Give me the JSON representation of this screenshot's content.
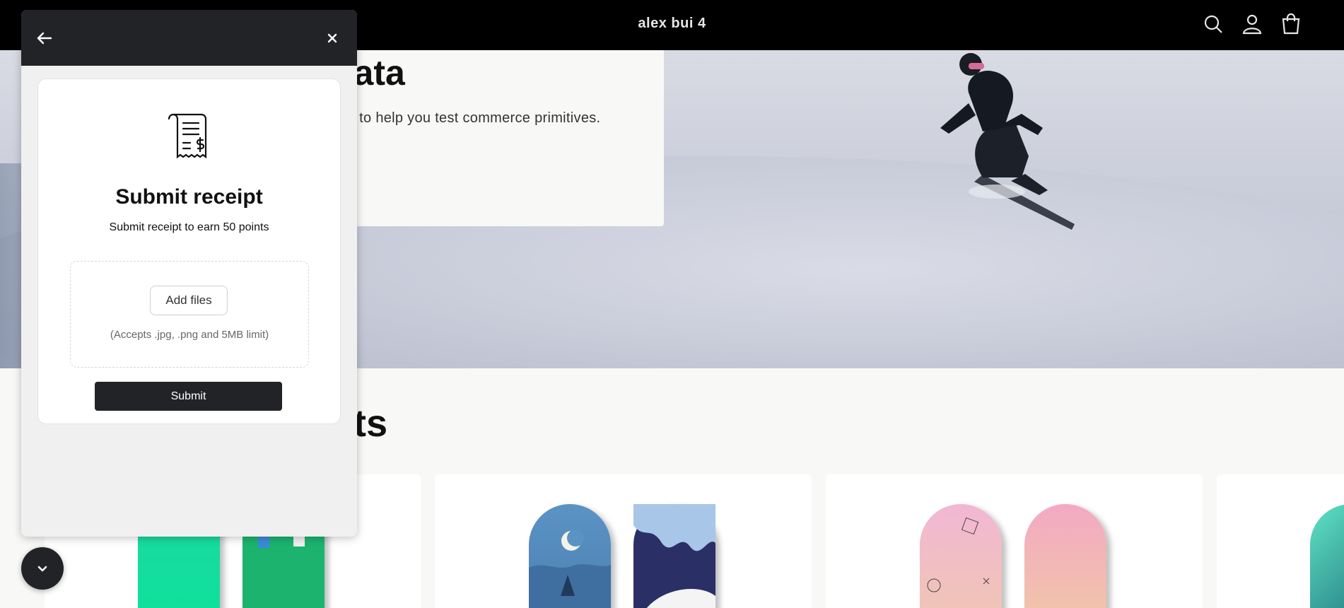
{
  "header": {
    "store_name": "alex bui 4",
    "icons": [
      "search-icon",
      "account-icon",
      "cart-icon"
    ]
  },
  "hero": {
    "title_fragment": "data",
    "subtitle_fragment": "pify to help you test commerce primitives."
  },
  "products": {
    "heading_fragment": "cts"
  },
  "widget": {
    "icons": [
      "back-arrow-icon",
      "close-icon",
      "receipt-icon",
      "chevron-down-icon"
    ],
    "title": "Submit receipt",
    "subtitle": "Submit receipt to earn 50 points",
    "add_files_label": "Add files",
    "accepts_note": "(Accepts .jpg, .png and 5MB limit)",
    "submit_label": "Submit"
  },
  "colors": {
    "header_bg": "#000000",
    "panel_head_bg": "#222327",
    "panel_bg": "#f0f0f0",
    "submit_bg": "#222327"
  }
}
